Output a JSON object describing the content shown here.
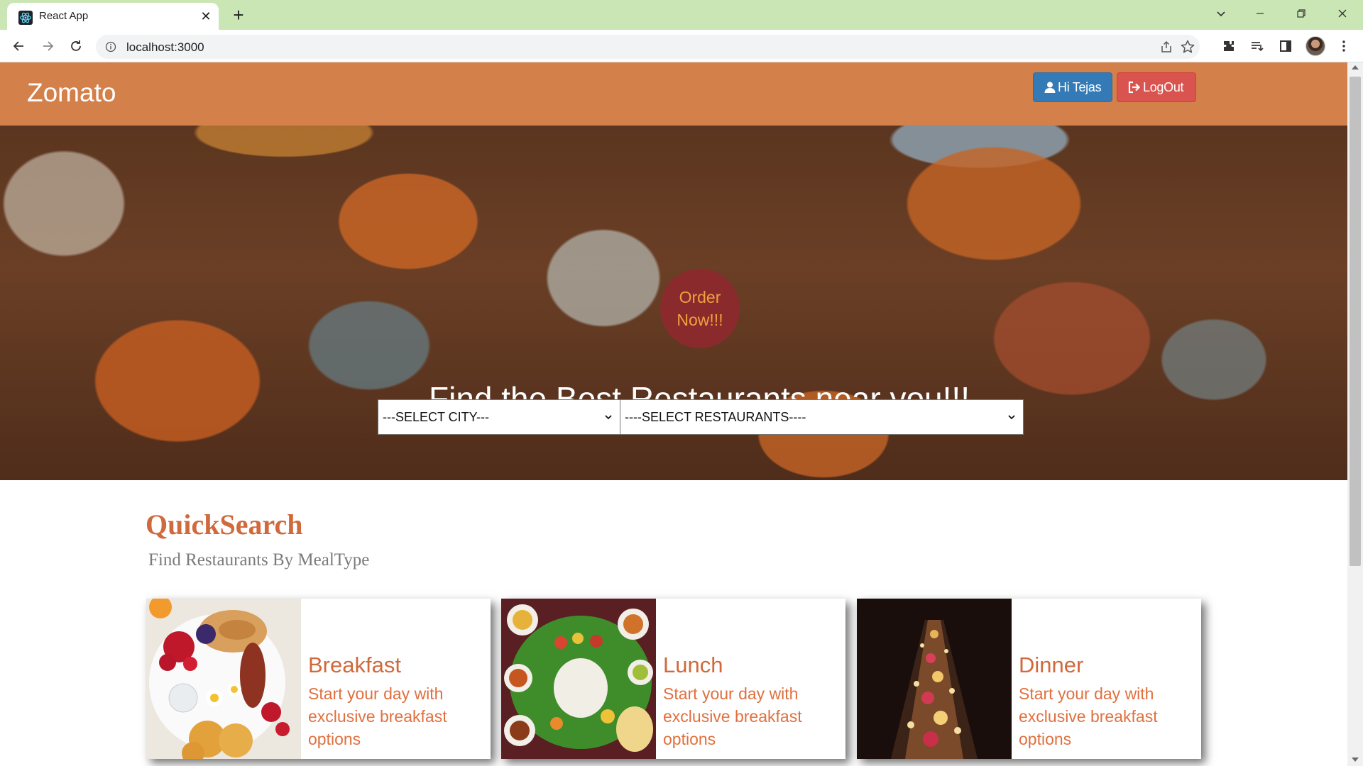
{
  "browser": {
    "tab": {
      "title": "React App"
    },
    "address_bar": {
      "url": "localhost:3000"
    }
  },
  "navbar": {
    "brand": "Zomato",
    "user_button": "Hi Tejas",
    "logout_button": "LogOut",
    "colors": {
      "background": "#d4804a",
      "user_button": "#337ab7",
      "logout_button": "#d9534f"
    }
  },
  "hero": {
    "badge": {
      "line1": "Order",
      "line2": "Now!!!"
    },
    "headline": "Find the Best Restaurants near you!!!",
    "city_select": {
      "selected": "---SELECT CITY---"
    },
    "restaurant_select": {
      "selected": "----SELECT RESTAURANTS----"
    }
  },
  "quicksearch": {
    "title": "QuickSearch",
    "subtitle": "Find Restaurants By MealType",
    "accent": "#d0693b",
    "cards": [
      {
        "title": "Breakfast",
        "description": "Start your day with exclusive breakfast options"
      },
      {
        "title": "Lunch",
        "description": "Start your day with exclusive breakfast options"
      },
      {
        "title": "Dinner",
        "description": "Start your day with exclusive breakfast options"
      }
    ]
  }
}
